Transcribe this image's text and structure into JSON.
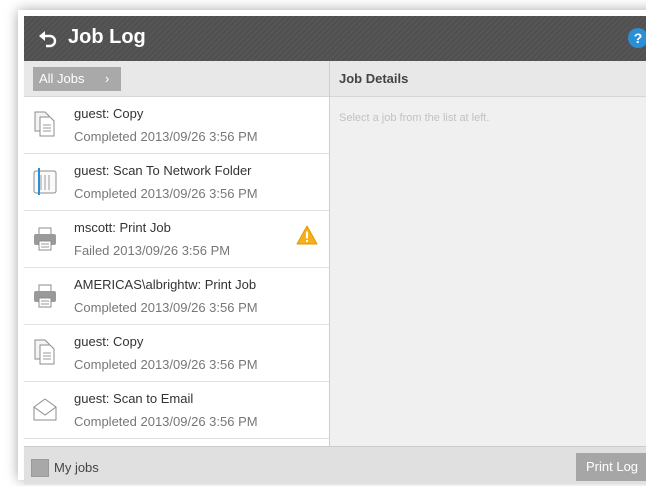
{
  "window": {
    "title": "Job Log",
    "help_label": "?"
  },
  "filter": {
    "label": "All Jobs",
    "chevron": "›"
  },
  "jobs": [
    {
      "name": "guest: Copy",
      "status": "Completed 2013/09/26 3:56 PM",
      "icon": "copy-icon",
      "warning": false
    },
    {
      "name": "guest: Scan To Network Folder",
      "status": "Completed 2013/09/26 3:56 PM",
      "icon": "scan-folder-icon",
      "warning": false
    },
    {
      "name": "mscott: Print Job",
      "status": "Failed 2013/09/26 3:56 PM",
      "icon": "printer-icon",
      "warning": true
    },
    {
      "name": "AMERICAS\\albrightw: Print Job",
      "status": "Completed 2013/09/26 3:56 PM",
      "icon": "printer-icon",
      "warning": false
    },
    {
      "name": "guest: Copy",
      "status": "Completed 2013/09/26 3:56 PM",
      "icon": "copy-icon",
      "warning": false
    },
    {
      "name": "guest: Scan to Email",
      "status": "Completed 2013/09/26 3:56 PM",
      "icon": "email-icon",
      "warning": false
    }
  ],
  "details": {
    "title": "Job Details",
    "hint": "Select a job from the list at left."
  },
  "footer": {
    "my_jobs_label": "My jobs",
    "print_log_label": "Print Log"
  },
  "colors": {
    "titlebar": "#525252",
    "help_accent": "#2b8fd6",
    "warning": "#f5b01c"
  }
}
